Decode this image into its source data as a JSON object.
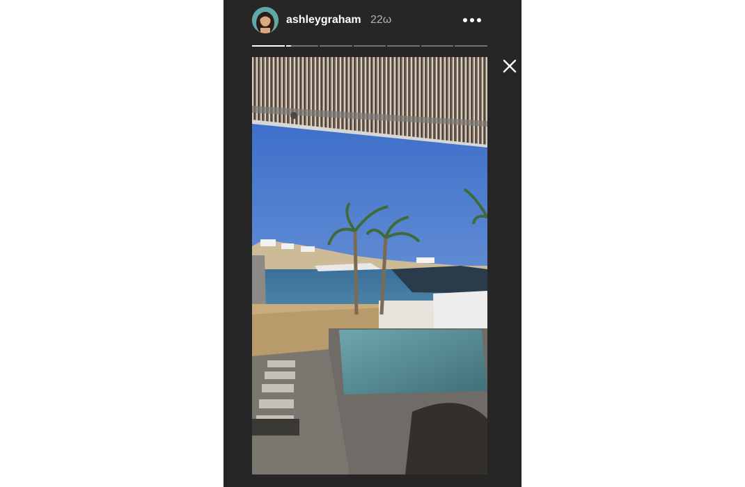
{
  "story": {
    "username": "ashleygraham",
    "timestamp": "22ω",
    "segments_total": 7,
    "active_segment_progress": [
      1.0,
      0.15,
      0,
      0,
      0,
      0,
      0
    ]
  },
  "icons": {
    "more": "more-dots-icon",
    "close": "close-icon"
  },
  "colors": {
    "panel_bg": "#262626",
    "page_bg": "#ffffff",
    "text_primary": "#ffffff",
    "text_secondary": "#b3b3b3"
  }
}
